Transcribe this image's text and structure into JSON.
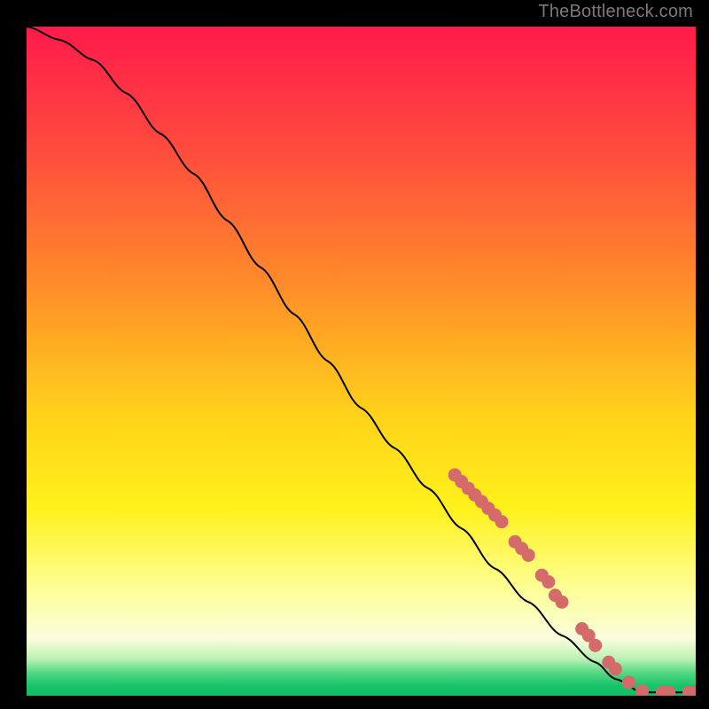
{
  "attribution": "TheBottleneck.com",
  "chart_data": {
    "type": "line",
    "title": "",
    "xlabel": "",
    "ylabel": "",
    "xlim": [
      0,
      100
    ],
    "ylim": [
      0,
      100
    ],
    "grid": false,
    "legend": false,
    "background": "heat-gradient",
    "curve": {
      "name": "bottleneck-curve",
      "x": [
        0,
        5,
        10,
        15,
        20,
        25,
        30,
        35,
        40,
        45,
        50,
        55,
        60,
        65,
        70,
        75,
        80,
        85,
        88,
        92,
        96,
        100
      ],
      "y": [
        100,
        98,
        95,
        90,
        84,
        78,
        71,
        64,
        57,
        50,
        43,
        37,
        31,
        25,
        19,
        14,
        9,
        5,
        2.5,
        0.5,
        0.5,
        0.5
      ]
    },
    "markers": {
      "name": "highlighted-points",
      "color": "#d46a6a",
      "points": [
        {
          "x": 64,
          "y": 33
        },
        {
          "x": 65,
          "y": 32
        },
        {
          "x": 66,
          "y": 31
        },
        {
          "x": 67,
          "y": 30
        },
        {
          "x": 68,
          "y": 29
        },
        {
          "x": 69,
          "y": 28
        },
        {
          "x": 70,
          "y": 27
        },
        {
          "x": 71,
          "y": 26
        },
        {
          "x": 73,
          "y": 23
        },
        {
          "x": 74,
          "y": 22
        },
        {
          "x": 75,
          "y": 21
        },
        {
          "x": 77,
          "y": 18
        },
        {
          "x": 78,
          "y": 17
        },
        {
          "x": 79,
          "y": 15
        },
        {
          "x": 80,
          "y": 14
        },
        {
          "x": 83,
          "y": 10
        },
        {
          "x": 84,
          "y": 9
        },
        {
          "x": 85,
          "y": 7.5
        },
        {
          "x": 87,
          "y": 5
        },
        {
          "x": 88,
          "y": 4
        },
        {
          "x": 90,
          "y": 2
        },
        {
          "x": 92,
          "y": 0.7
        },
        {
          "x": 95,
          "y": 0.5
        },
        {
          "x": 96,
          "y": 0.5
        },
        {
          "x": 99,
          "y": 0.5
        },
        {
          "x": 100,
          "y": 0.5
        }
      ]
    },
    "gradient_stops": [
      {
        "offset": 0.0,
        "color": "#ff1a4b"
      },
      {
        "offset": 0.18,
        "color": "#ff4a3e"
      },
      {
        "offset": 0.38,
        "color": "#ff8a2a"
      },
      {
        "offset": 0.58,
        "color": "#ffd21a"
      },
      {
        "offset": 0.72,
        "color": "#fff11a"
      },
      {
        "offset": 0.85,
        "color": "#fdffa0"
      },
      {
        "offset": 0.915,
        "color": "#fafddc"
      },
      {
        "offset": 0.945,
        "color": "#b9f2b4"
      },
      {
        "offset": 0.965,
        "color": "#57d985"
      },
      {
        "offset": 0.985,
        "color": "#18c36a"
      },
      {
        "offset": 1.0,
        "color": "#0fbf63"
      }
    ]
  }
}
